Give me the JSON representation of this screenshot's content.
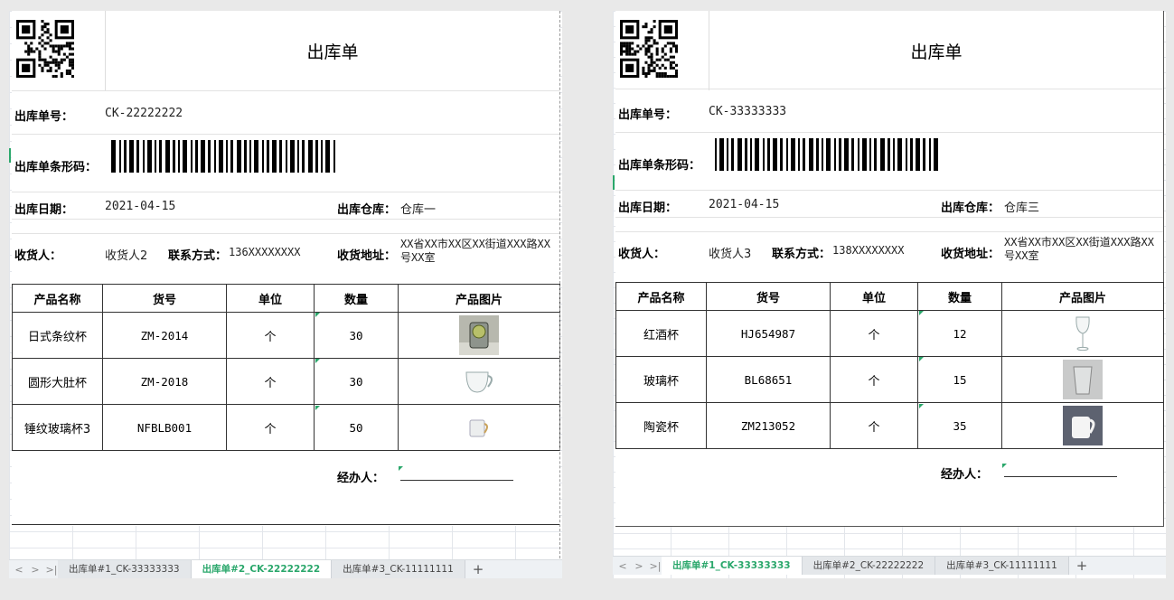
{
  "colors": {
    "accent": "#2aa76b",
    "border": "#333333",
    "grid": "#e3e6eb"
  },
  "sheets": [
    {
      "title": "出库单",
      "order_no_label": "出库单号：",
      "order_no": "CK-22222222",
      "barcode_label": "出库单条形码：",
      "date_label": "出库日期：",
      "date": "2021-04-15",
      "warehouse_label": "出库仓库：",
      "warehouse": "仓库一",
      "receiver_label": "收货人：",
      "receiver": "收货人2",
      "contact_label": "联系方式：",
      "contact": "136XXXXXXXX",
      "address_label": "收货地址：",
      "address": "XX省XX市XX区XX街道XXX路XX号XX室",
      "columns": [
        "产品名称",
        "货号",
        "单位",
        "数量",
        "产品图片"
      ],
      "rows": [
        {
          "name": "日式条纹杯",
          "sku": "ZM-2014",
          "unit": "个",
          "qty": "30",
          "image": "glass-lemon-image"
        },
        {
          "name": "圆形大肚杯",
          "sku": "ZM-2018",
          "unit": "个",
          "qty": "30",
          "image": "clear-mug-image"
        },
        {
          "name": "锤纹玻璃杯3",
          "sku": "NFBLB001",
          "unit": "个",
          "qty": "50",
          "image": "hammered-mug-image"
        }
      ],
      "handler_label": "经办人：",
      "tabs": [
        "出库单#1_CK-33333333",
        "出库单#2_CK-22222222",
        "出库单#3_CK-11111111"
      ],
      "active_tab": 1
    },
    {
      "title": "出库单",
      "order_no_label": "出库单号：",
      "order_no": "CK-33333333",
      "barcode_label": "出库单条形码：",
      "date_label": "出库日期：",
      "date": "2021-04-15",
      "warehouse_label": "出库仓库：",
      "warehouse": "仓库三",
      "receiver_label": "收货人：",
      "receiver": "收货人3",
      "contact_label": "联系方式：",
      "contact": "138XXXXXXXX",
      "address_label": "收货地址：",
      "address": "XX省XX市XX区XX街道XXX路XX号XX室",
      "columns": [
        "产品名称",
        "货号",
        "单位",
        "数量",
        "产品图片"
      ],
      "rows": [
        {
          "name": "红酒杯",
          "sku": "HJ654987",
          "unit": "个",
          "qty": "12",
          "image": "wine-glass-image"
        },
        {
          "name": "玻璃杯",
          "sku": "BL68651",
          "unit": "个",
          "qty": "15",
          "image": "tumbler-image"
        },
        {
          "name": "陶瓷杯",
          "sku": "ZM213052",
          "unit": "个",
          "qty": "35",
          "image": "ceramic-mug-image"
        }
      ],
      "handler_label": "经办人：",
      "tabs": [
        "出库单#1_CK-33333333",
        "出库单#2_CK-22222222",
        "出库单#3_CK-11111111"
      ],
      "active_tab": 0
    }
  ]
}
